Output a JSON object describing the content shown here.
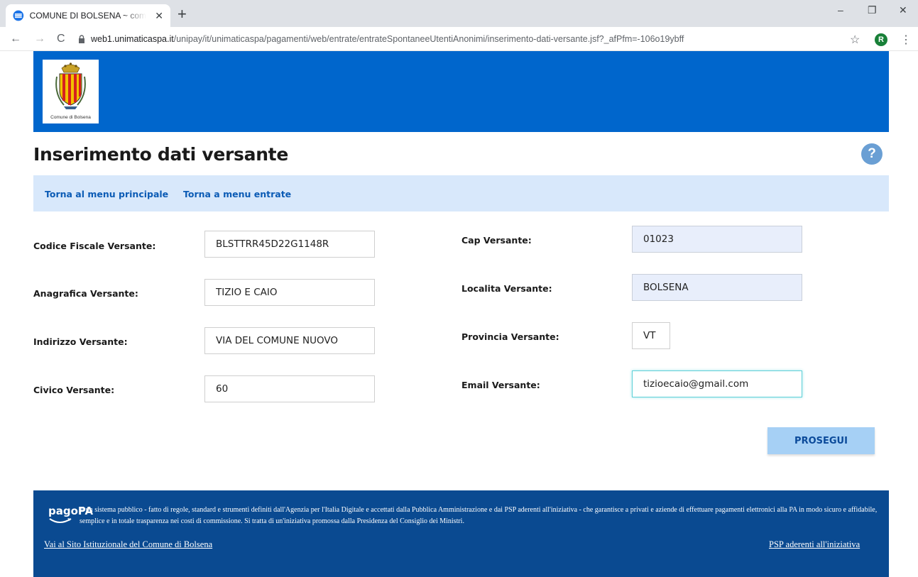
{
  "browser": {
    "tab_title": "COMUNE DI BOLSENA ~ combo",
    "tab_close": "✕",
    "new_tab": "+",
    "url_prefix": "web1.unimaticaspa.it",
    "url_path": "/unipay/it/unimaticaspa/pagamenti/web/entrate/entrateSpontaneeUtentiAnonimi/inserimento-dati-versante.jsf?_afPfm=-106o19ybff",
    "profile_initial": "R",
    "minimize": "–",
    "restore": "❐",
    "close": "✕",
    "back": "←",
    "forward": "→",
    "reload": "C",
    "star": "☆",
    "menu": "⋮"
  },
  "header": {
    "logo_caption": "Comune di Bolsena"
  },
  "page": {
    "title": "Inserimento dati versante",
    "help": "?"
  },
  "subnav": {
    "link_main": "Torna al menu principale",
    "link_entrate": "Torna a menu entrate"
  },
  "form": {
    "codice_fiscale": {
      "label": "Codice Fiscale Versante:",
      "value": "BLSTTRR45D22G1148R"
    },
    "anagrafica": {
      "label": "Anagrafica Versante:",
      "value": "TIZIO E CAIO"
    },
    "indirizzo": {
      "label": "Indirizzo Versante:",
      "value": "VIA DEL COMUNE NUOVO"
    },
    "civico": {
      "label": "Civico Versante:",
      "value": "60"
    },
    "cap": {
      "label": "Cap Versante:",
      "value": "01023"
    },
    "localita": {
      "label": "Localita Versante:",
      "value": "BOLSENA"
    },
    "provincia": {
      "label": "Provincia Versante:",
      "value": "VT"
    },
    "email": {
      "label": "Email Versante:",
      "value": "tizioecaio@gmail.com"
    },
    "submit_label": "PROSEGUI"
  },
  "footer": {
    "logo_text": "pagoPA",
    "description": "e' un sistema pubblico - fatto di regole, standard e strumenti definiti dall'Agenzia per l'Italia Digitale e accettati dalla Pubblica Amministrazione e dai PSP aderenti all'iniziativa - che garantisce a privati e aziende di effettuare pagamenti elettronici alla PA in modo sicuro e affidabile, semplice e in totale trasparenza nei costi di commissione. Si tratta di un'iniziativa promossa dalla Presidenza del Consiglio dei Ministri.",
    "link_site": "Vai al Sito Istituzionale del Comune di Bolsena",
    "link_psp": "PSP aderenti all'iniziativa"
  },
  "colors": {
    "header_blue": "#0066cc",
    "subnav_bg": "#d8e8fb",
    "footer_blue": "#0a4a91",
    "link_blue": "#0b5bb5",
    "submit_bg": "#a6d0f5"
  }
}
